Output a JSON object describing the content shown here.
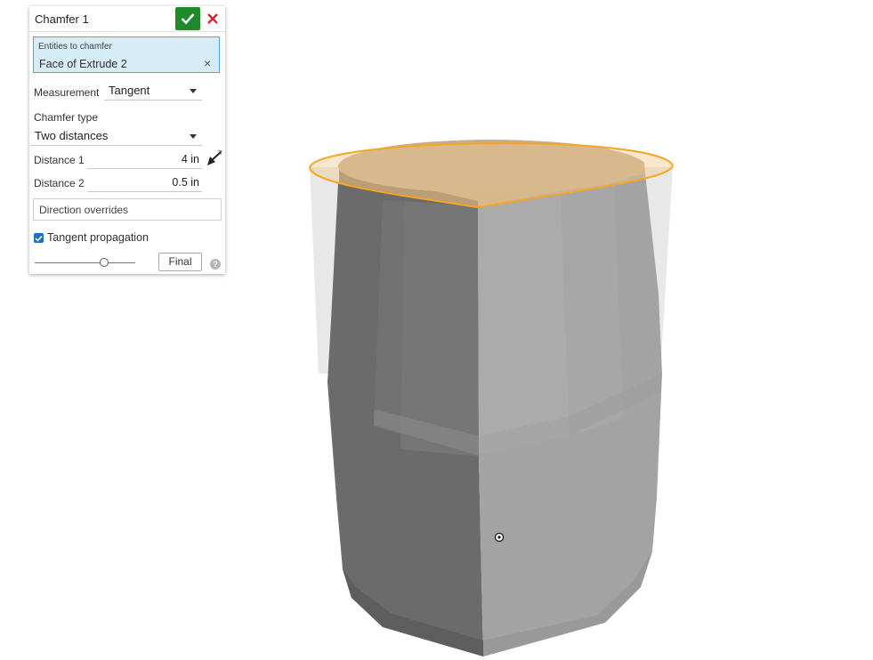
{
  "dialog": {
    "title": "Chamfer 1",
    "confirm_icon": "check-icon",
    "cancel_icon": "close-icon",
    "entities_label": "Entities to chamfer",
    "entities_value": "Face of Extrude 2",
    "clear_glyph": "×",
    "measurement_label": "Measurement",
    "measurement_value": "Tangent",
    "chamfer_type_label": "Chamfer type",
    "chamfer_type_value": "Two distances",
    "distance1_label": "Distance 1",
    "distance1_value": "4 in",
    "distance2_label": "Distance 2",
    "distance2_value": "0.5 in",
    "direction_overrides": "Direction overrides",
    "tangent_propagation_label": "Tangent propagation",
    "tangent_propagation_checked": true,
    "final_button": "Final",
    "help_glyph": "?",
    "flip_icon": "flip-direction-arrow-icon"
  },
  "colors": {
    "confirm": "#1d8a2b",
    "cancel": "#d0262f",
    "selection_highlight": "#f5a623",
    "query_fill": "#d6edf8"
  }
}
